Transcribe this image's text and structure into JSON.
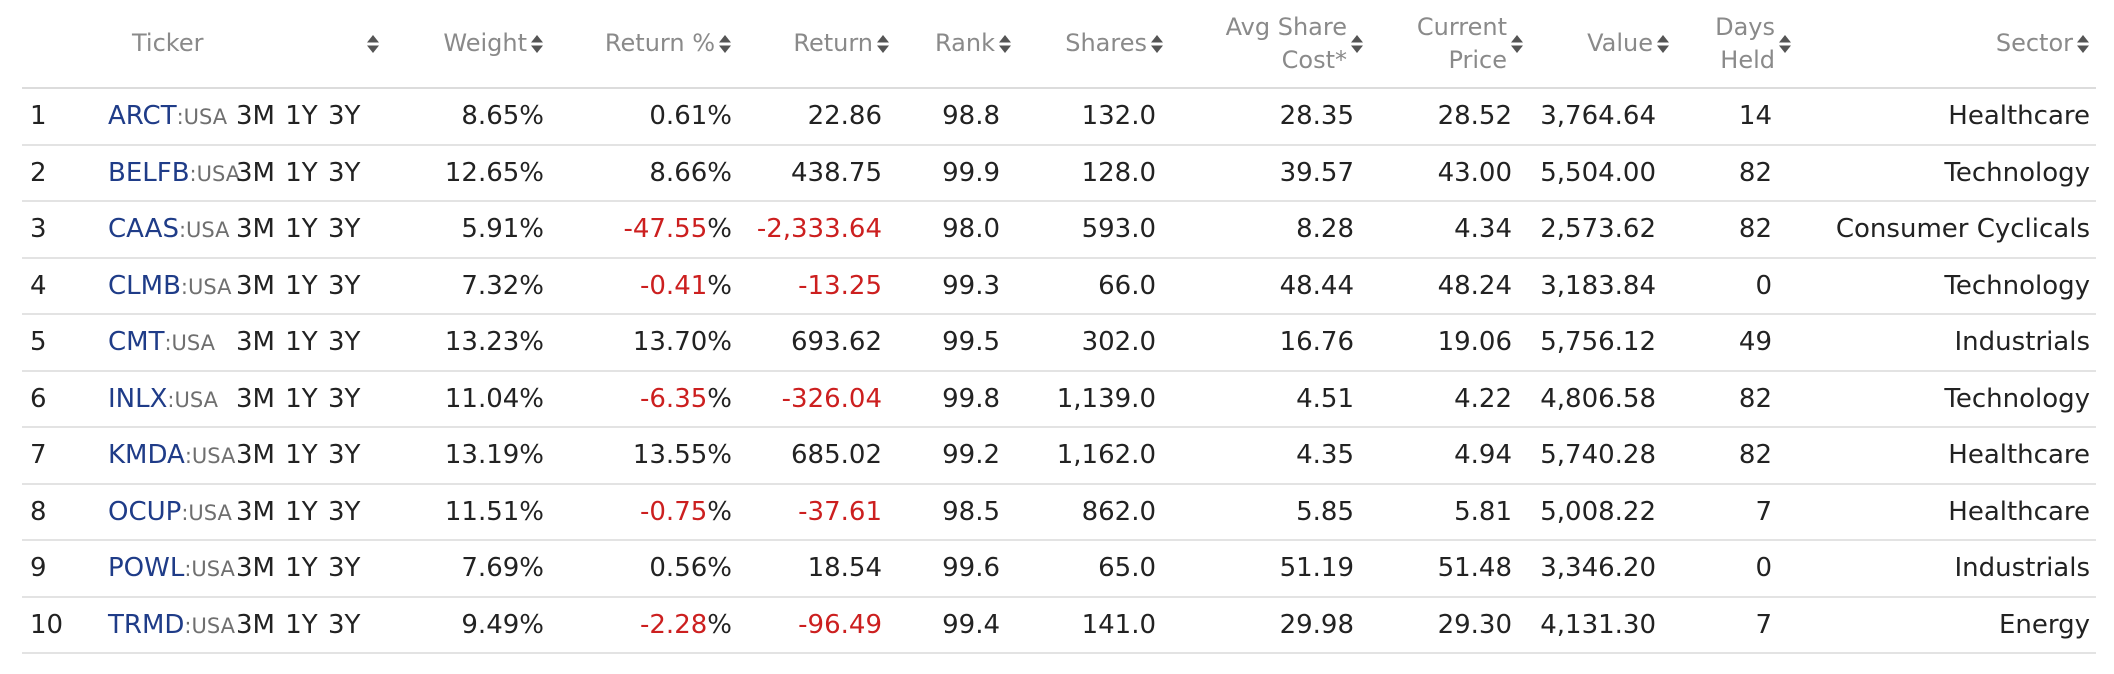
{
  "columns": {
    "ticker": "Ticker",
    "weight": "Weight",
    "return_pct": "Return %",
    "return": "Return",
    "rank": "Rank",
    "shares": "Shares",
    "avg_cost_1": "Avg Share",
    "avg_cost_2": "Cost*",
    "price_1": "Current",
    "price_2": "Price",
    "value": "Value",
    "days_1": "Days",
    "days_2": "Held",
    "sector": "Sector"
  },
  "periods": [
    "3M",
    "1Y",
    "3Y"
  ],
  "colors": {
    "link": "#1f3c88",
    "negative": "#cc1f1f",
    "header": "#8a8a8a"
  },
  "icons": {
    "sort": "sort-arrows-icon"
  },
  "rows": [
    {
      "n": "1",
      "ticker": "ARCT",
      "exchange": ":USA",
      "weight": "8.65%",
      "ret_num": "0.61",
      "ret_neg": false,
      "ret": "22.86",
      "rank": "98.8",
      "shares": "132.0",
      "avg": "28.35",
      "price": "28.52",
      "value": "3,764.64",
      "days": "14",
      "sector": "Healthcare"
    },
    {
      "n": "2",
      "ticker": "BELFB",
      "exchange": ":USA",
      "weight": "12.65%",
      "ret_num": "8.66",
      "ret_neg": false,
      "ret": "438.75",
      "rank": "99.9",
      "shares": "128.0",
      "avg": "39.57",
      "price": "43.00",
      "value": "5,504.00",
      "days": "82",
      "sector": "Technology"
    },
    {
      "n": "3",
      "ticker": "CAAS",
      "exchange": ":USA",
      "weight": "5.91%",
      "ret_num": "-47.55",
      "ret_neg": true,
      "ret": "-2,333.64",
      "rank": "98.0",
      "shares": "593.0",
      "avg": "8.28",
      "price": "4.34",
      "value": "2,573.62",
      "days": "82",
      "sector": "Consumer Cyclicals"
    },
    {
      "n": "4",
      "ticker": "CLMB",
      "exchange": ":USA",
      "weight": "7.32%",
      "ret_num": "-0.41",
      "ret_neg": true,
      "ret": "-13.25",
      "rank": "99.3",
      "shares": "66.0",
      "avg": "48.44",
      "price": "48.24",
      "value": "3,183.84",
      "days": "0",
      "sector": "Technology"
    },
    {
      "n": "5",
      "ticker": "CMT",
      "exchange": ":USA",
      "weight": "13.23%",
      "ret_num": "13.70",
      "ret_neg": false,
      "ret": "693.62",
      "rank": "99.5",
      "shares": "302.0",
      "avg": "16.76",
      "price": "19.06",
      "value": "5,756.12",
      "days": "49",
      "sector": "Industrials"
    },
    {
      "n": "6",
      "ticker": "INLX",
      "exchange": ":USA",
      "weight": "11.04%",
      "ret_num": "-6.35",
      "ret_neg": true,
      "ret": "-326.04",
      "rank": "99.8",
      "shares": "1,139.0",
      "avg": "4.51",
      "price": "4.22",
      "value": "4,806.58",
      "days": "82",
      "sector": "Technology"
    },
    {
      "n": "7",
      "ticker": "KMDA",
      "exchange": ":USA",
      "weight": "13.19%",
      "ret_num": "13.55",
      "ret_neg": false,
      "ret": "685.02",
      "rank": "99.2",
      "shares": "1,162.0",
      "avg": "4.35",
      "price": "4.94",
      "value": "5,740.28",
      "days": "82",
      "sector": "Healthcare"
    },
    {
      "n": "8",
      "ticker": "OCUP",
      "exchange": ":USA",
      "weight": "11.51%",
      "ret_num": "-0.75",
      "ret_neg": true,
      "ret": "-37.61",
      "rank": "98.5",
      "shares": "862.0",
      "avg": "5.85",
      "price": "5.81",
      "value": "5,008.22",
      "days": "7",
      "sector": "Healthcare"
    },
    {
      "n": "9",
      "ticker": "POWL",
      "exchange": ":USA",
      "weight": "7.69%",
      "ret_num": "0.56",
      "ret_neg": false,
      "ret": "18.54",
      "rank": "99.6",
      "shares": "65.0",
      "avg": "51.19",
      "price": "51.48",
      "value": "3,346.20",
      "days": "0",
      "sector": "Industrials"
    },
    {
      "n": "10",
      "ticker": "TRMD",
      "exchange": ":USA",
      "weight": "9.49%",
      "ret_num": "-2.28",
      "ret_neg": true,
      "ret": "-96.49",
      "rank": "99.4",
      "shares": "141.0",
      "avg": "29.98",
      "price": "29.30",
      "value": "4,131.30",
      "days": "7",
      "sector": "Energy"
    }
  ]
}
